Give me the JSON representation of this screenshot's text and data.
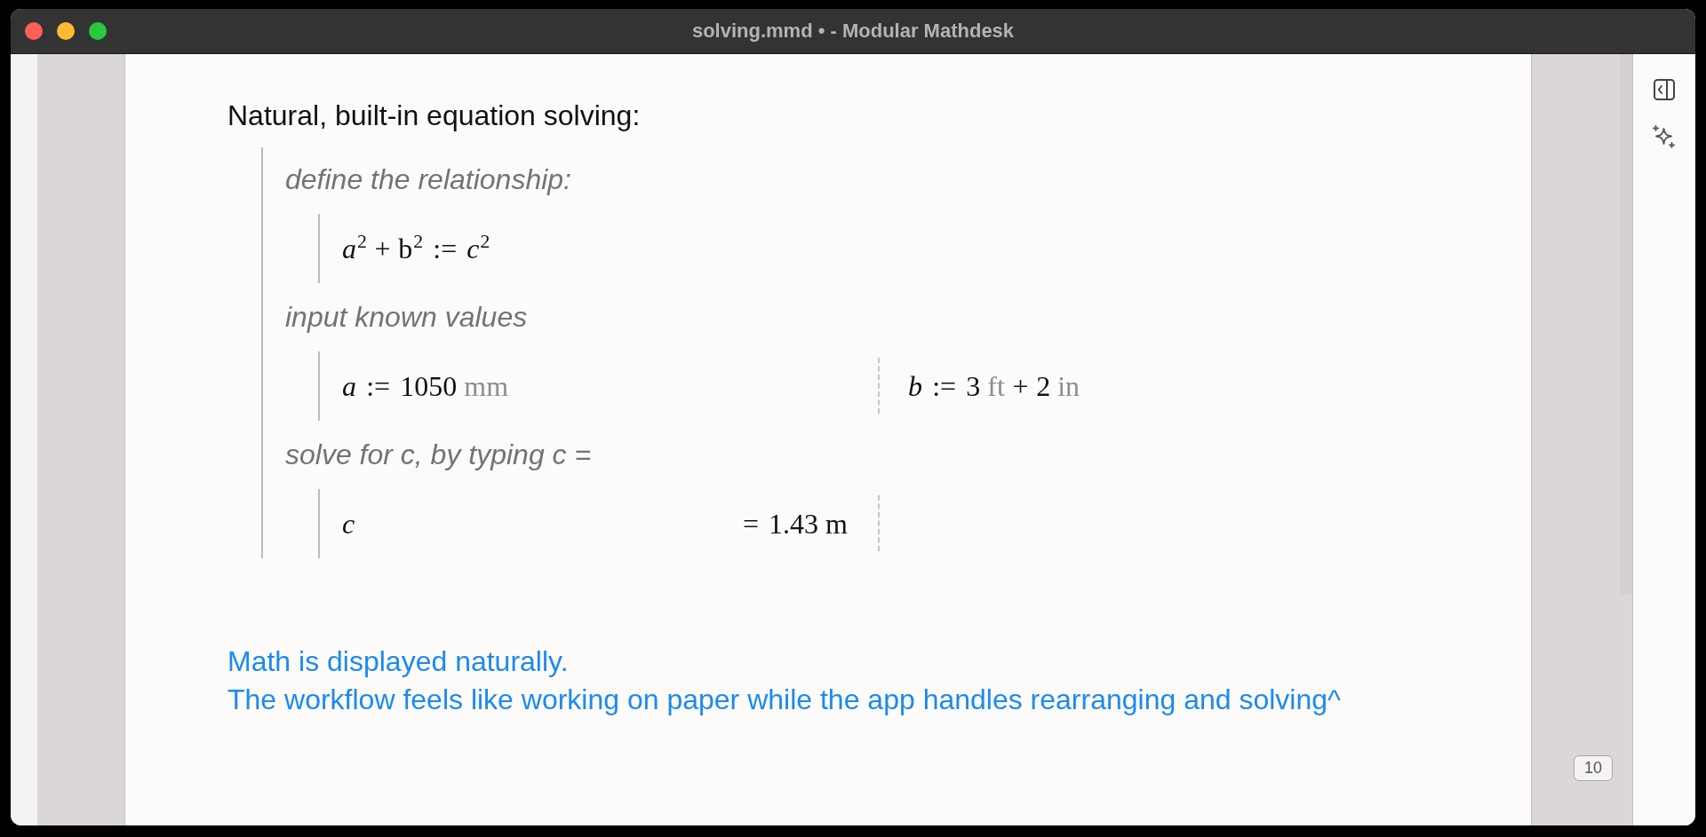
{
  "window": {
    "title": "solving.mmd • - Modular Mathdesk"
  },
  "document": {
    "heading": "Natural, built-in equation solving:",
    "steps": [
      {
        "caption": "define the relationship:",
        "block": {
          "kind": "single",
          "cells": [
            {
              "expression": [
                {
                  "kind": "var",
                  "text": "a"
                },
                {
                  "kind": "sup",
                  "text": "2"
                },
                {
                  "kind": "op",
                  "text": "+"
                },
                {
                  "kind": "roman",
                  "text": "b"
                },
                {
                  "kind": "sup",
                  "text": "2"
                },
                {
                  "kind": "rel",
                  "text": ":="
                },
                {
                  "kind": "var",
                  "text": "c"
                },
                {
                  "kind": "sup",
                  "text": "2"
                }
              ]
            }
          ]
        }
      },
      {
        "caption": "input known values",
        "block": {
          "kind": "columns",
          "cells": [
            {
              "expression": [
                {
                  "kind": "var",
                  "text": "a"
                },
                {
                  "kind": "rel",
                  "text": ":="
                },
                {
                  "kind": "roman",
                  "text": "1050"
                },
                {
                  "kind": "unit",
                  "text": "mm"
                }
              ]
            },
            {
              "expression": [
                {
                  "kind": "var",
                  "text": "b"
                },
                {
                  "kind": "rel",
                  "text": ":="
                },
                {
                  "kind": "roman",
                  "text": "3"
                },
                {
                  "kind": "unit",
                  "text": "ft"
                },
                {
                  "kind": "op",
                  "text": "+"
                },
                {
                  "kind": "roman",
                  "text": "2"
                },
                {
                  "kind": "unit",
                  "text": "in"
                }
              ]
            }
          ]
        }
      },
      {
        "caption": "solve for c, by typing c =",
        "block": {
          "kind": "columns",
          "cells": [
            {
              "expression": [
                {
                  "kind": "var",
                  "text": "c"
                }
              ],
              "result": [
                {
                  "kind": "rel",
                  "text": "="
                },
                {
                  "kind": "roman",
                  "text": "1.43 m"
                }
              ]
            }
          ]
        }
      }
    ],
    "notes": [
      "Math is displayed naturally.",
      "The workflow feels like working on paper while the app handles rearranging and solving^"
    ],
    "page_number": "10"
  }
}
